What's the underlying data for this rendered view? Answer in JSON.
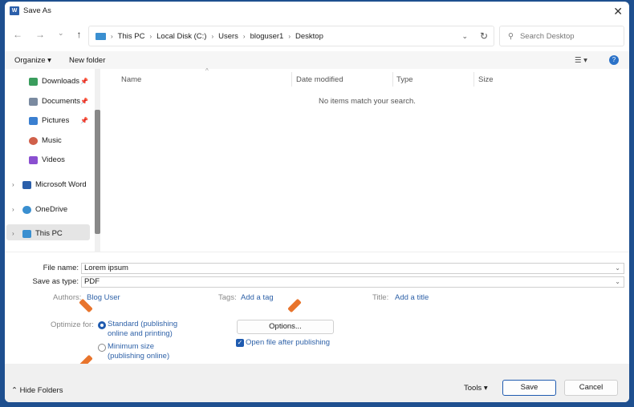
{
  "window": {
    "title": "Save As",
    "app_icon": "W"
  },
  "nav": {
    "back": "←",
    "forward": "→",
    "recent": "⌄",
    "up": "↑"
  },
  "address": {
    "crumbs": [
      "This PC",
      "Local Disk (C:)",
      "Users",
      "bloguser1",
      "Desktop"
    ]
  },
  "search": {
    "placeholder": "Search Desktop"
  },
  "toolbar": {
    "organize": "Organize ▾",
    "new_folder": "New folder",
    "help": "?"
  },
  "sidebar": {
    "items": [
      {
        "label": "Downloads",
        "color": "#3a9d5d"
      },
      {
        "label": "Documents",
        "color": "#7a8aa0"
      },
      {
        "label": "Pictures",
        "color": "#3a7fd0"
      },
      {
        "label": "Music",
        "color": "#d0604a"
      },
      {
        "label": "Videos",
        "color": "#8a4fd0"
      },
      {
        "label": "Microsoft Word",
        "color": "#2b5faa"
      },
      {
        "label": "OneDrive",
        "color": "#3a8fd0"
      },
      {
        "label": "This PC",
        "color": "#3a8fd0"
      }
    ]
  },
  "columns": [
    "Name",
    "Date modified",
    "Type",
    "Size"
  ],
  "empty_message": "No items match your search.",
  "form": {
    "file_name_label": "File name:",
    "file_name": "Lorem ipsum",
    "type_label": "Save as type:",
    "type": "PDF",
    "authors_label": "Authors:",
    "authors": "Blog User",
    "tags_label": "Tags:",
    "tags": "Add a tag",
    "title_label": "Title:",
    "title": "Add a title",
    "optimize_label": "Optimize for:",
    "opt_standard_1": "Standard (publishing",
    "opt_standard_2": "online and printing)",
    "opt_min_1": "Minimum size",
    "opt_min_2": "(publishing online)",
    "options": "Options...",
    "open_after": "Open file after publishing"
  },
  "footer": {
    "hide_folders": "Hide Folders",
    "tools": "Tools",
    "save": "Save",
    "cancel": "Cancel"
  }
}
